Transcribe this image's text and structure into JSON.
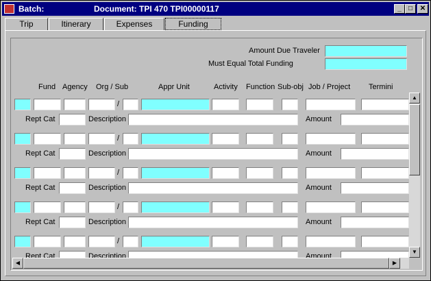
{
  "titlebar": {
    "app": "Batch:",
    "document": "Document:  TPI   470   TPI00000117",
    "minimize": "_",
    "maximize": "□",
    "close": "✕"
  },
  "tabs": [
    "Trip",
    "Itinerary",
    "Expenses",
    "Funding"
  ],
  "active_tab": "Funding",
  "summary": {
    "amount_due_label": "Amount Due Traveler",
    "must_equal_label": "Must Equal  Total Funding"
  },
  "columns": {
    "fund": "Fund",
    "agency": "Agency",
    "org_sub": "Org / Sub",
    "appr_unit": "Appr Unit",
    "activity": "Activity",
    "function": "Function",
    "sub_obj": "Sub-obj",
    "job_project": "Job / Project",
    "termini": "Termini"
  },
  "row_labels": {
    "slash": "/",
    "rept_cat": "Rept Cat",
    "description": "Description",
    "amount": "Amount"
  },
  "rows": [
    {},
    {},
    {},
    {},
    {}
  ],
  "icons": {
    "scroll_up": "▲",
    "scroll_down": "▼",
    "scroll_left": "◀",
    "scroll_right": "▶"
  }
}
